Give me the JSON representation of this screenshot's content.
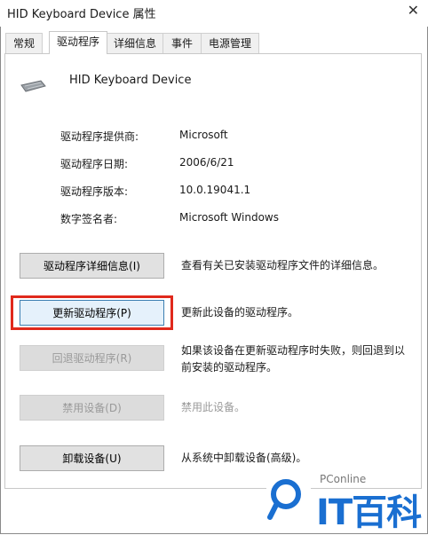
{
  "window": {
    "title": "HID Keyboard Device 属性",
    "close_glyph": "✕"
  },
  "tabs": [
    {
      "label": "常规",
      "active": false
    },
    {
      "label": "驱动程序",
      "active": true
    },
    {
      "label": "详细信息",
      "active": false
    },
    {
      "label": "事件",
      "active": false
    },
    {
      "label": "电源管理",
      "active": false
    }
  ],
  "device": {
    "name": "HID Keyboard Device",
    "icon": "keyboard-icon"
  },
  "info": [
    {
      "label": "驱动程序提供商:",
      "value": "Microsoft"
    },
    {
      "label": "驱动程序日期:",
      "value": "2006/6/21"
    },
    {
      "label": "驱动程序版本:",
      "value": "10.0.19041.1"
    },
    {
      "label": "数字签名者:",
      "value": "Microsoft Windows"
    }
  ],
  "actions": [
    {
      "button": "驱动程序详细信息(I)",
      "description": "查看有关已安装驱动程序文件的详细信息。",
      "enabled": true
    },
    {
      "button": "更新驱动程序(P)",
      "description": "更新此设备的驱动程序。",
      "enabled": true,
      "highlighted": true
    },
    {
      "button": "回退驱动程序(R)",
      "description": "如果该设备在更新驱动程序时失败，则回退到以前安装的驱动程序。",
      "enabled": false
    },
    {
      "button": "禁用设备(D)",
      "description": "禁用此设备。",
      "enabled": false
    },
    {
      "button": "卸载设备(U)",
      "description": "从系统中卸载设备(高级)。",
      "enabled": true
    }
  ],
  "watermark": {
    "small": "PConline",
    "big": "IT百科"
  },
  "colors": {
    "highlight": "#e0291c",
    "brand": "#1a6fd1"
  }
}
